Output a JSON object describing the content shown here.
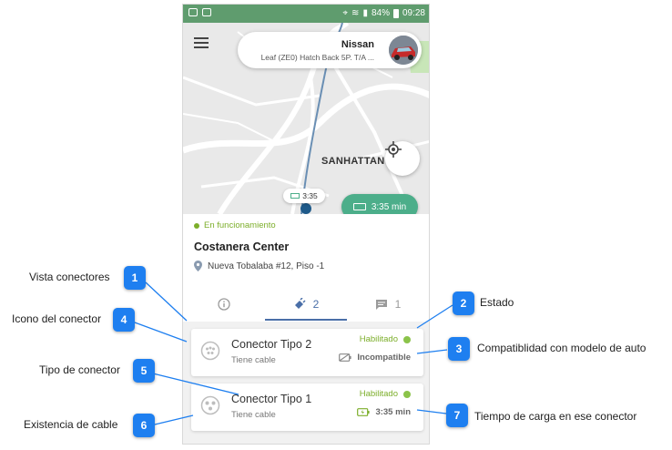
{
  "status_bar": {
    "battery": "84%",
    "time": "09:28"
  },
  "car": {
    "brand": "Nissan",
    "model": "Leaf (ZE0) Hatch Back 5P. T/A ..."
  },
  "map": {
    "district_label": "SANHATTAN",
    "pill_time": "3:35",
    "charge_time": "3:35 min"
  },
  "station": {
    "status": "En funcionamiento",
    "name": "Costanera Center",
    "address": "Nueva Tobalaba #12, Piso -1"
  },
  "tabs": {
    "connectors_count": "2",
    "comments_count": "1"
  },
  "connectors": [
    {
      "title": "Conector Tipo 2",
      "cable": "Tiene cable",
      "state": "Habilitado",
      "compat": "Incompatible"
    },
    {
      "title": "Conector Tipo 1",
      "cable": "Tiene cable",
      "state": "Habilitado",
      "time": "3:35 min"
    }
  ],
  "annotations": [
    {
      "num": "1",
      "text": "Vista conectores"
    },
    {
      "num": "2",
      "text": "Estado"
    },
    {
      "num": "3",
      "text": "Compatiblidad con modelo de auto"
    },
    {
      "num": "4",
      "text": "Icono del conector"
    },
    {
      "num": "5",
      "text": "Tipo de conector"
    },
    {
      "num": "6",
      "text": "Existencia de cable"
    },
    {
      "num": "7",
      "text": "Tiempo de carga en ese conector"
    }
  ],
  "colors": {
    "accent_green": "#7cae2a",
    "chip_green": "#4cae8a",
    "tab_blue": "#4a6fa8",
    "badge_blue": "#1e7ff0"
  }
}
